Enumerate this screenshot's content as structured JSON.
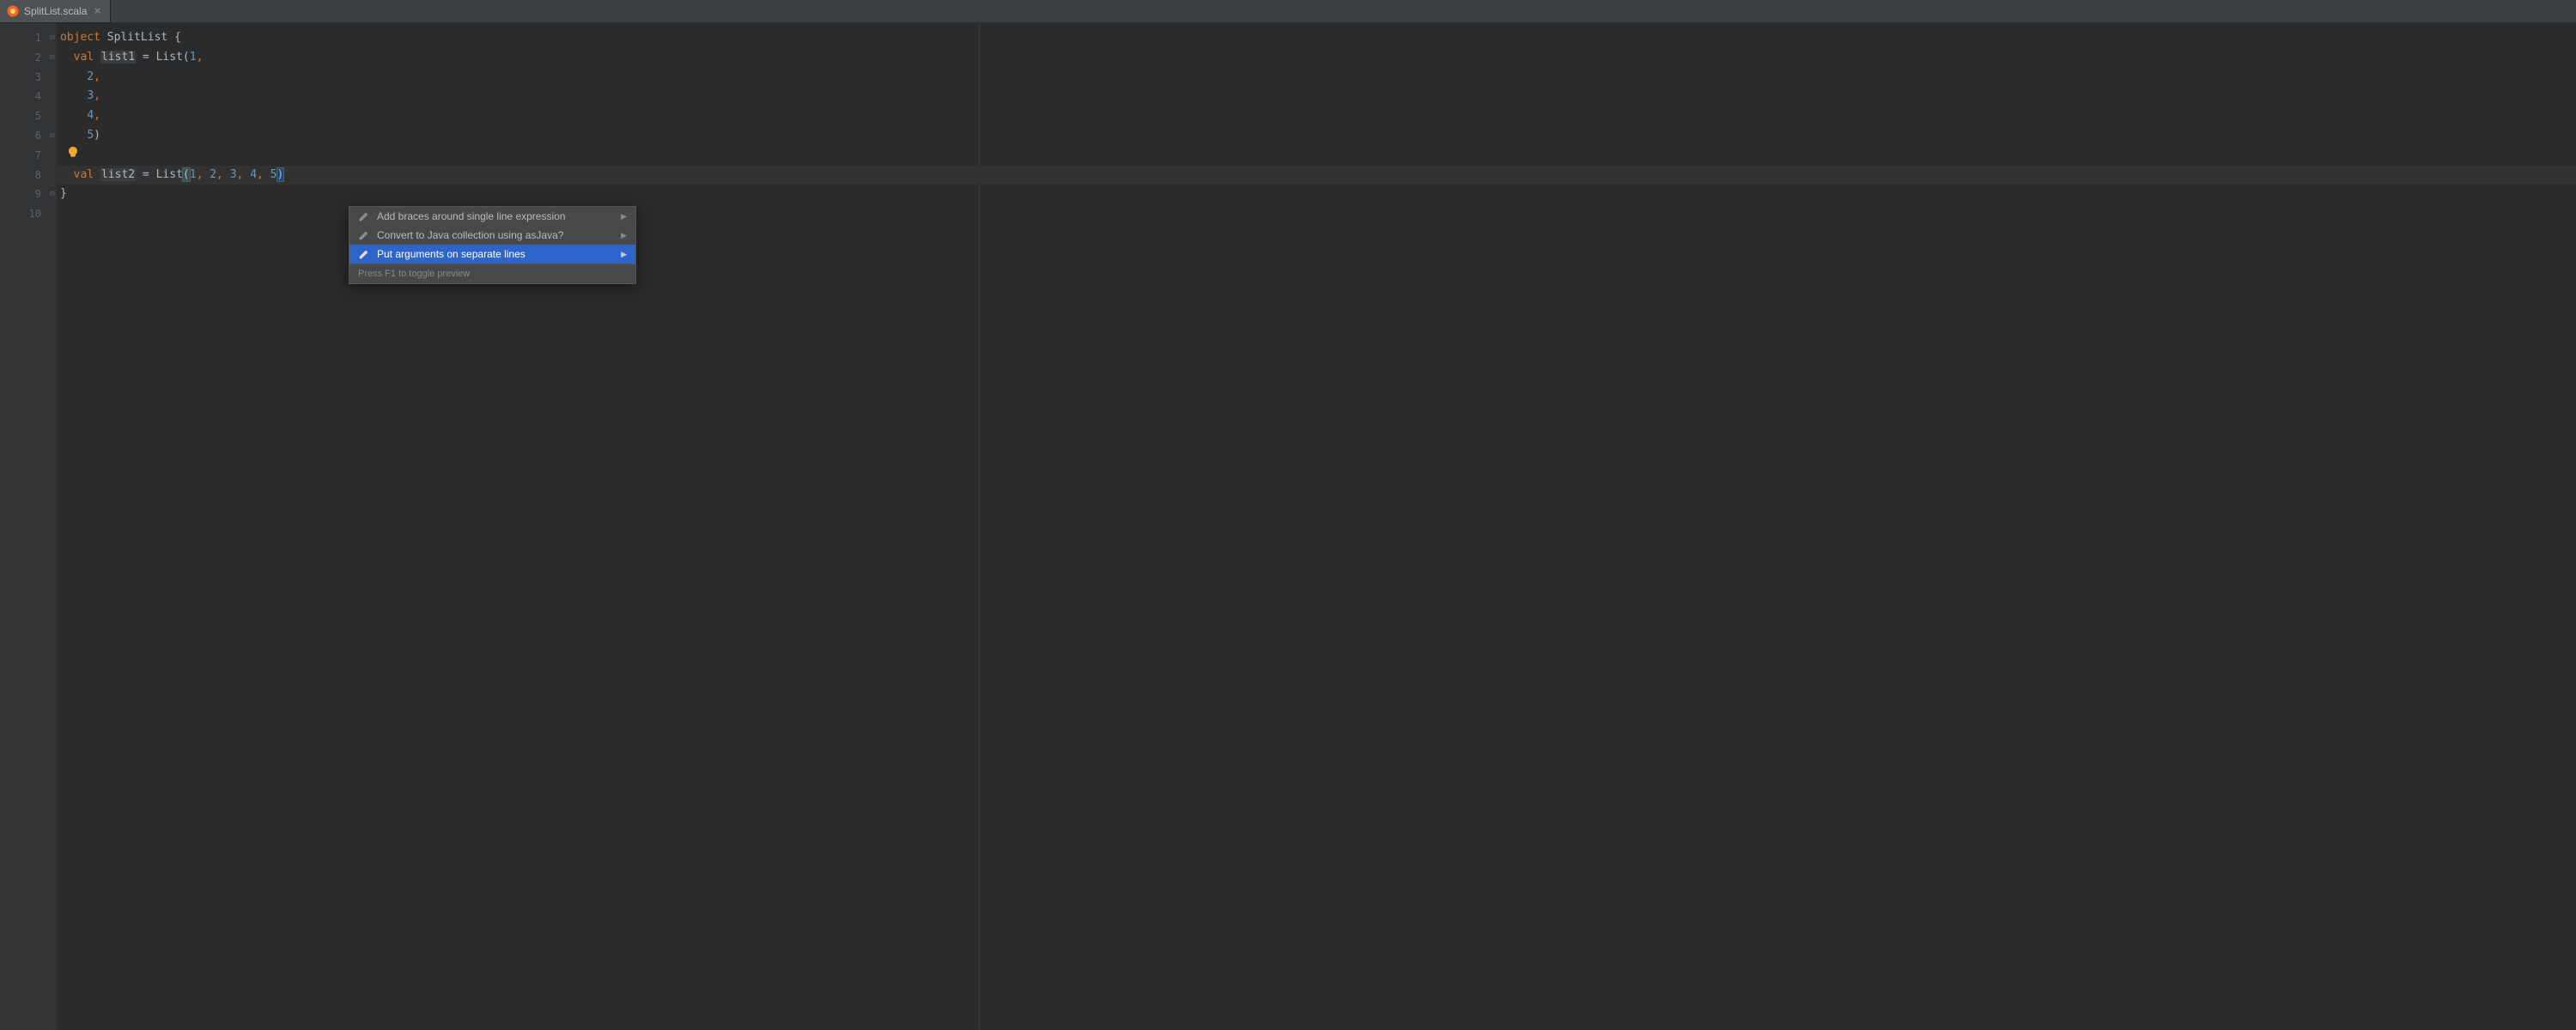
{
  "tab": {
    "filename": "SplitList.scala"
  },
  "gutter": {
    "lines": [
      "1",
      "2",
      "3",
      "4",
      "5",
      "6",
      "7",
      "8",
      "9",
      "10"
    ]
  },
  "code": {
    "line1": {
      "kw": "object",
      "name": " SplitList ",
      "brace": "{"
    },
    "line2": {
      "indent": "  ",
      "kw": "val",
      "var": "list1",
      "eq": " = List(",
      "num": "1",
      "comma": ","
    },
    "line3": {
      "indent": "    ",
      "num": "2",
      "comma": ","
    },
    "line4": {
      "indent": "    ",
      "num": "3",
      "comma": ","
    },
    "line5": {
      "indent": "    ",
      "num": "4",
      "comma": ","
    },
    "line6": {
      "indent": "    ",
      "num": "5",
      "close": ")"
    },
    "line8": {
      "indent": "  ",
      "kw": "val",
      "var": "list2",
      "eq": " = List",
      "open": "(",
      "n1": "1",
      "c1": ", ",
      "n2": "2",
      "c2": ", ",
      "n3": "3",
      "c3": ", ",
      "n4": "4",
      "c4": ", ",
      "n5": "5",
      "close": ")"
    },
    "line9": {
      "brace": "}"
    }
  },
  "intentions": {
    "item1": "Add braces around single line expression",
    "item2": "Convert to Java collection using asJava?",
    "item3": "Put arguments on separate lines",
    "footer": "Press F1 to toggle preview"
  }
}
